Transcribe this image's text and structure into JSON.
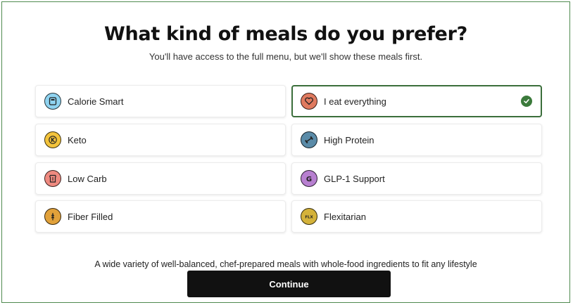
{
  "header": {
    "title": "What kind of meals do you prefer?",
    "subtitle": "You'll have access to the full menu, but we'll show these meals first."
  },
  "options": [
    {
      "label": "Calorie Smart",
      "icon": "scale-icon",
      "color": "#8fd3f0",
      "selected": false
    },
    {
      "label": "I eat everything",
      "icon": "heart-icon",
      "color": "#e07a5f",
      "selected": true
    },
    {
      "label": "Keto",
      "icon": "keto-k-icon",
      "color": "#f3c33b",
      "selected": false
    },
    {
      "label": "High Protein",
      "icon": "dumbbell-icon",
      "color": "#5a8ba8",
      "selected": false
    },
    {
      "label": "Low Carb",
      "icon": "bread-icon",
      "color": "#ef8a80",
      "selected": false
    },
    {
      "label": "GLP-1 Support",
      "icon": "glp-g-icon",
      "color": "#b77fd0",
      "selected": false
    },
    {
      "label": "Fiber Filled",
      "icon": "wheat-icon",
      "color": "#e1a13a",
      "selected": false
    },
    {
      "label": "Flexitarian",
      "icon": "flx-icon",
      "color": "#d4b23a",
      "selected": false
    }
  ],
  "icon_text": {
    "keto": "K",
    "glp": "G",
    "flx": "FLX"
  },
  "description": "A wide variety of well-balanced, chef-prepared meals with whole-food ingredients to fit any lifestyle",
  "continue_label": "Continue",
  "colors": {
    "selected_border": "#3b6e3b",
    "check": "#3b7a3b",
    "button": "#111111"
  }
}
